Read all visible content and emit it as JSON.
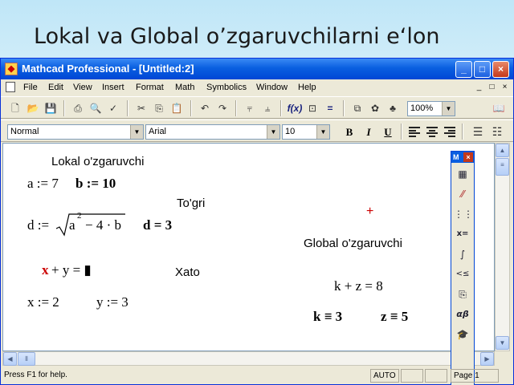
{
  "slide": {
    "title": "Lokal va Global o’zgaruvchilarni e‘lon"
  },
  "window": {
    "title": "Mathcad Professional - [Untitled:2]",
    "buttons": {
      "minimize": "_",
      "maximize": "□",
      "close": "×"
    }
  },
  "menubar": {
    "items": [
      "File",
      "Edit",
      "View",
      "Insert",
      "Format",
      "Math",
      "Symbolics",
      "Window",
      "Help"
    ],
    "mdi": {
      "minimize": "_",
      "restore": "□",
      "close": "×"
    }
  },
  "toolbar": {
    "zoom": "100%"
  },
  "format_toolbar": {
    "style": "Normal",
    "font": "Arial",
    "size": "10",
    "bold": "B",
    "italic": "I",
    "underline": "U"
  },
  "worksheet": {
    "lokal_heading": "Lokal o'zgaruvchi",
    "line1_a": "a := 7",
    "line1_b": "b := 10",
    "togri_label": "To'gri",
    "d_def_lhs": "d :=",
    "d_radicand_a": "a",
    "d_radicand_exp": "2",
    "d_radicand_rest": "− 4 · b",
    "d_result": "d = 3",
    "xato_label": "Xato",
    "err_x": "x",
    "err_rest": "+ y = ▮",
    "x_def": "x := 2",
    "y_def": "y := 3",
    "global_heading": "Global o'zgaruvchi",
    "kz_eval": "k + z = 8",
    "k_global": "k ≡ 3",
    "z_global": "z ≡ 5",
    "red_cursor": "+"
  },
  "palette": {
    "title": "M",
    "close": "×",
    "icons": [
      "calculator-icon",
      "graph-icon",
      "matrix-icon",
      "evaluation-icon",
      "calculus-icon",
      "boolean-icon",
      "programming-icon",
      "greek-icon",
      "symbolic-icon"
    ],
    "glyphs": [
      "▦",
      "⁄⁄",
      "⋮⋮",
      "x=",
      "∫",
      "<≤",
      "⎘",
      "αβ",
      "🎓"
    ]
  },
  "statusbar": {
    "help": "Press F1 for help.",
    "mode": "AUTO",
    "page": "Page 1"
  },
  "colors": {
    "title_bar": "#0a5fe0",
    "error_red": "#cc0000",
    "chrome": "#ece9d8"
  }
}
